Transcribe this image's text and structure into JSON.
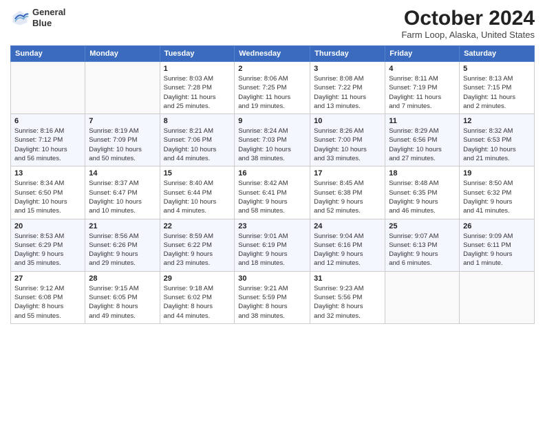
{
  "logo": {
    "line1": "General",
    "line2": "Blue"
  },
  "title": "October 2024",
  "subtitle": "Farm Loop, Alaska, United States",
  "days_of_week": [
    "Sunday",
    "Monday",
    "Tuesday",
    "Wednesday",
    "Thursday",
    "Friday",
    "Saturday"
  ],
  "weeks": [
    [
      {
        "day": "",
        "info": ""
      },
      {
        "day": "",
        "info": ""
      },
      {
        "day": "1",
        "info": "Sunrise: 8:03 AM\nSunset: 7:28 PM\nDaylight: 11 hours\nand 25 minutes."
      },
      {
        "day": "2",
        "info": "Sunrise: 8:06 AM\nSunset: 7:25 PM\nDaylight: 11 hours\nand 19 minutes."
      },
      {
        "day": "3",
        "info": "Sunrise: 8:08 AM\nSunset: 7:22 PM\nDaylight: 11 hours\nand 13 minutes."
      },
      {
        "day": "4",
        "info": "Sunrise: 8:11 AM\nSunset: 7:19 PM\nDaylight: 11 hours\nand 7 minutes."
      },
      {
        "day": "5",
        "info": "Sunrise: 8:13 AM\nSunset: 7:15 PM\nDaylight: 11 hours\nand 2 minutes."
      }
    ],
    [
      {
        "day": "6",
        "info": "Sunrise: 8:16 AM\nSunset: 7:12 PM\nDaylight: 10 hours\nand 56 minutes."
      },
      {
        "day": "7",
        "info": "Sunrise: 8:19 AM\nSunset: 7:09 PM\nDaylight: 10 hours\nand 50 minutes."
      },
      {
        "day": "8",
        "info": "Sunrise: 8:21 AM\nSunset: 7:06 PM\nDaylight: 10 hours\nand 44 minutes."
      },
      {
        "day": "9",
        "info": "Sunrise: 8:24 AM\nSunset: 7:03 PM\nDaylight: 10 hours\nand 38 minutes."
      },
      {
        "day": "10",
        "info": "Sunrise: 8:26 AM\nSunset: 7:00 PM\nDaylight: 10 hours\nand 33 minutes."
      },
      {
        "day": "11",
        "info": "Sunrise: 8:29 AM\nSunset: 6:56 PM\nDaylight: 10 hours\nand 27 minutes."
      },
      {
        "day": "12",
        "info": "Sunrise: 8:32 AM\nSunset: 6:53 PM\nDaylight: 10 hours\nand 21 minutes."
      }
    ],
    [
      {
        "day": "13",
        "info": "Sunrise: 8:34 AM\nSunset: 6:50 PM\nDaylight: 10 hours\nand 15 minutes."
      },
      {
        "day": "14",
        "info": "Sunrise: 8:37 AM\nSunset: 6:47 PM\nDaylight: 10 hours\nand 10 minutes."
      },
      {
        "day": "15",
        "info": "Sunrise: 8:40 AM\nSunset: 6:44 PM\nDaylight: 10 hours\nand 4 minutes."
      },
      {
        "day": "16",
        "info": "Sunrise: 8:42 AM\nSunset: 6:41 PM\nDaylight: 9 hours\nand 58 minutes."
      },
      {
        "day": "17",
        "info": "Sunrise: 8:45 AM\nSunset: 6:38 PM\nDaylight: 9 hours\nand 52 minutes."
      },
      {
        "day": "18",
        "info": "Sunrise: 8:48 AM\nSunset: 6:35 PM\nDaylight: 9 hours\nand 46 minutes."
      },
      {
        "day": "19",
        "info": "Sunrise: 8:50 AM\nSunset: 6:32 PM\nDaylight: 9 hours\nand 41 minutes."
      }
    ],
    [
      {
        "day": "20",
        "info": "Sunrise: 8:53 AM\nSunset: 6:29 PM\nDaylight: 9 hours\nand 35 minutes."
      },
      {
        "day": "21",
        "info": "Sunrise: 8:56 AM\nSunset: 6:26 PM\nDaylight: 9 hours\nand 29 minutes."
      },
      {
        "day": "22",
        "info": "Sunrise: 8:59 AM\nSunset: 6:22 PM\nDaylight: 9 hours\nand 23 minutes."
      },
      {
        "day": "23",
        "info": "Sunrise: 9:01 AM\nSunset: 6:19 PM\nDaylight: 9 hours\nand 18 minutes."
      },
      {
        "day": "24",
        "info": "Sunrise: 9:04 AM\nSunset: 6:16 PM\nDaylight: 9 hours\nand 12 minutes."
      },
      {
        "day": "25",
        "info": "Sunrise: 9:07 AM\nSunset: 6:13 PM\nDaylight: 9 hours\nand 6 minutes."
      },
      {
        "day": "26",
        "info": "Sunrise: 9:09 AM\nSunset: 6:11 PM\nDaylight: 9 hours\nand 1 minute."
      }
    ],
    [
      {
        "day": "27",
        "info": "Sunrise: 9:12 AM\nSunset: 6:08 PM\nDaylight: 8 hours\nand 55 minutes."
      },
      {
        "day": "28",
        "info": "Sunrise: 9:15 AM\nSunset: 6:05 PM\nDaylight: 8 hours\nand 49 minutes."
      },
      {
        "day": "29",
        "info": "Sunrise: 9:18 AM\nSunset: 6:02 PM\nDaylight: 8 hours\nand 44 minutes."
      },
      {
        "day": "30",
        "info": "Sunrise: 9:21 AM\nSunset: 5:59 PM\nDaylight: 8 hours\nand 38 minutes."
      },
      {
        "day": "31",
        "info": "Sunrise: 9:23 AM\nSunset: 5:56 PM\nDaylight: 8 hours\nand 32 minutes."
      },
      {
        "day": "",
        "info": ""
      },
      {
        "day": "",
        "info": ""
      }
    ]
  ]
}
